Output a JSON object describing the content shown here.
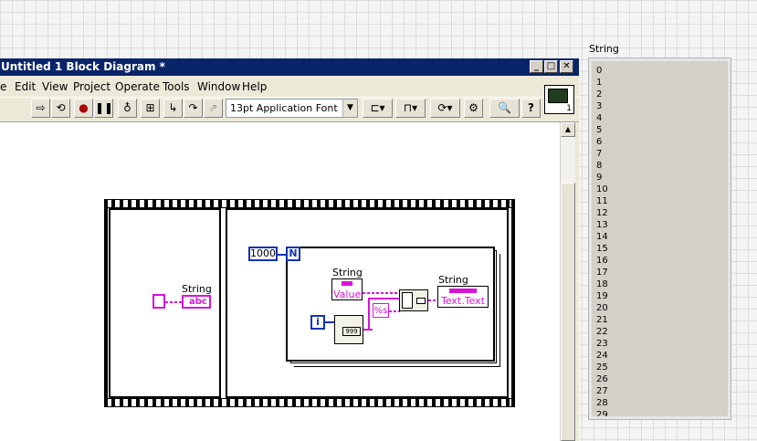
{
  "window": {
    "title": "Untitled 1 Block Diagram *"
  },
  "menu": {
    "items": [
      "e",
      "Edit",
      "View",
      "Project",
      "Operate",
      "Tools",
      "Window",
      "Help"
    ]
  },
  "toolbar": {
    "font_select": "13pt Application Font",
    "icon_number": "1"
  },
  "diagram": {
    "string_label": "String",
    "abc_label": "abc",
    "loop_count": "1000",
    "loop_n": "N",
    "loop_i": "i",
    "property_string_label": "String",
    "value_label": "Value",
    "string_out_label": "String",
    "text_text": "Text.Text",
    "format_label": "%s"
  },
  "front_panel": {
    "string_label": "String",
    "lines": [
      "0",
      "1",
      "2",
      "3",
      "4",
      "5",
      "6",
      "7",
      "8",
      "9",
      "10",
      "11",
      "12",
      "13",
      "14",
      "15",
      "16",
      "17",
      "18",
      "19",
      "20",
      "21",
      "22",
      "23",
      "24",
      "25",
      "26",
      "27",
      "28",
      "29"
    ]
  },
  "colors": {
    "title_bar": "#0a246a",
    "string_wire": "#d813d8",
    "numeric_blue": "#1431b4"
  }
}
